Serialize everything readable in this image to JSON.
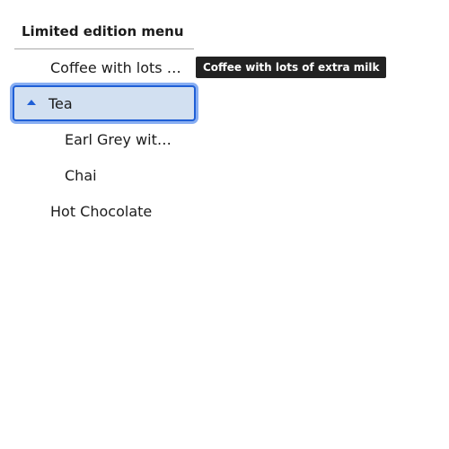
{
  "tree": {
    "header": "Limited edition menu",
    "items": [
      {
        "label": "Coffee with lots of extra milk"
      },
      {
        "label": "Tea",
        "expanded": true,
        "selected": true,
        "children": [
          {
            "label": "Earl Grey with milk"
          },
          {
            "label": "Chai"
          }
        ]
      },
      {
        "label": "Hot Chocolate"
      }
    ]
  },
  "tooltip": {
    "text": "Coffee with lots of extra milk"
  },
  "colors": {
    "selected_background": "#d2e0f1",
    "focus_border": "#1f5fd6",
    "tooltip_background": "#222222"
  }
}
